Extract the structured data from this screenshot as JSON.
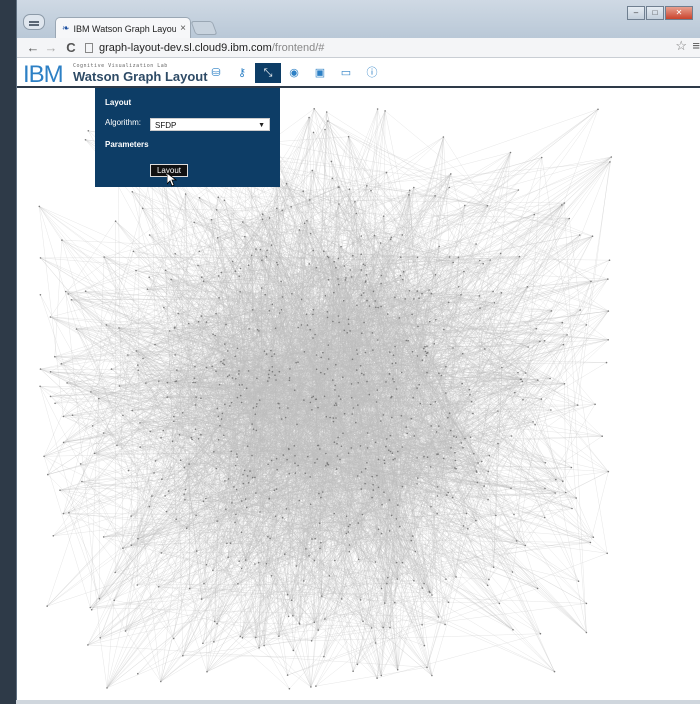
{
  "browser": {
    "tab_title": "IBM Watson Graph Layout",
    "tab_close": "×",
    "url_host": "graph-layout-dev.sl.cloud9.ibm.com",
    "url_path": "/frontend/#",
    "nav": {
      "back": "←",
      "forward": "→",
      "reload": "C"
    },
    "star": "☆",
    "menu": "≡",
    "controls": {
      "minimize": "–",
      "maximize": "□",
      "close": "✕"
    }
  },
  "app": {
    "logo": "IBM",
    "lab_label": "Cognitive Visualization Lab",
    "title": "Watson Graph Layout",
    "nav_icons": [
      {
        "name": "database-icon",
        "glyph": "⛁",
        "active": false
      },
      {
        "name": "key-icon",
        "glyph": "⚷",
        "active": false
      },
      {
        "name": "layout-icon",
        "glyph": "⤡",
        "active": true
      },
      {
        "name": "eye-icon",
        "glyph": "◉",
        "active": false
      },
      {
        "name": "image-icon",
        "glyph": "▣",
        "active": false
      },
      {
        "name": "monitor-icon",
        "glyph": "▭",
        "active": false
      },
      {
        "name": "info-icon",
        "glyph": "ⓘ",
        "active": false
      }
    ]
  },
  "layout_panel": {
    "heading": "Layout",
    "algorithm_label": "Algorithm:",
    "algorithm_value": "SFDP",
    "parameters_heading": "Parameters",
    "button_label": "Layout"
  },
  "colors": {
    "panel_bg": "#0d3d66",
    "logo_blue": "#2d80c5",
    "edge_gray": "#bdbdbd",
    "node_gray": "#7a7a7a"
  }
}
